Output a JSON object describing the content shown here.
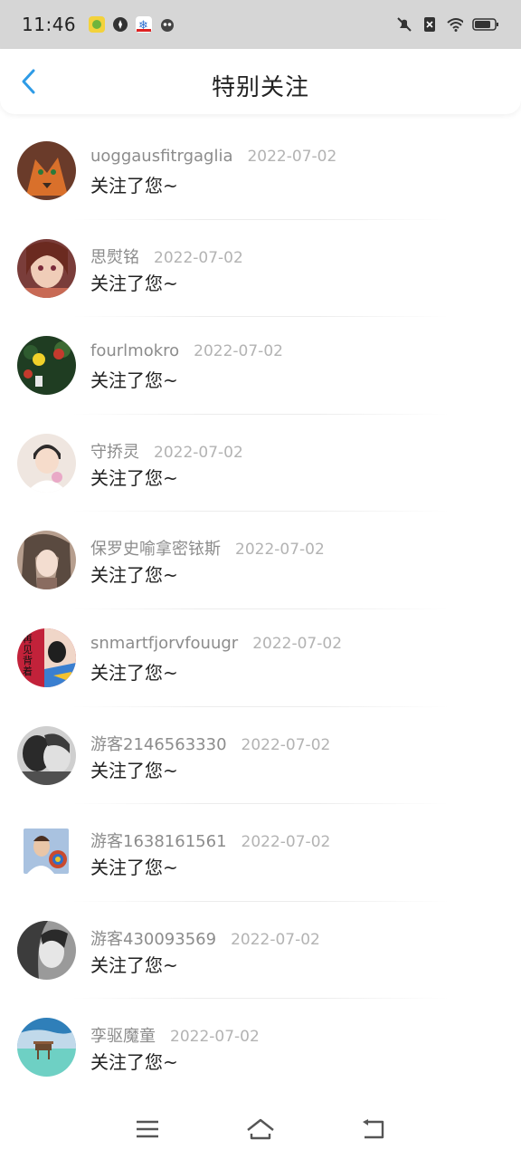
{
  "status_bar": {
    "time": "11:46",
    "apps": [
      "app-yellow-icon",
      "app-compass-icon",
      "app-snowflake-icon",
      "app-cat-icon"
    ],
    "system": [
      "mute-icon",
      "sim-icon",
      "wifi-icon",
      "battery-icon"
    ]
  },
  "header": {
    "title": "特别关注",
    "back_icon": "chevron-left-icon",
    "accent": "#2e9be6"
  },
  "items": [
    {
      "username": "uoggausfitrgaglia",
      "date": "2022-07-02",
      "message": "关注了您~",
      "avatar_colors": [
        "#d9702b",
        "#6a3b2a"
      ]
    },
    {
      "username": "思熨铭",
      "date": "2022-07-02",
      "message": "关注了您~",
      "avatar_colors": [
        "#c86a55",
        "#7a3d3a"
      ]
    },
    {
      "username": "fourlmokro",
      "date": "2022-07-02",
      "message": "关注了您~",
      "avatar_colors": [
        "#2e5b2f",
        "#c43a2d"
      ]
    },
    {
      "username": "守挢灵",
      "date": "2022-07-02",
      "message": "关注了您~",
      "avatar_colors": [
        "#efe6e0",
        "#2d2b2b"
      ]
    },
    {
      "username": "保罗史喻拿密铱斯",
      "date": "2022-07-02",
      "message": "关注了您~",
      "avatar_colors": [
        "#b69e8e",
        "#5a4a40"
      ]
    },
    {
      "username": "snmartfjorvfouugr",
      "date": "2022-07-02",
      "message": "关注了您~",
      "avatar_colors": [
        "#c2223a",
        "#f0d6c8"
      ],
      "avatar_text": "再见背着"
    },
    {
      "username": "游客2146563330",
      "date": "2022-07-02",
      "message": "关注了您~",
      "avatar_colors": [
        "#505050",
        "#cfcfcf"
      ]
    },
    {
      "username": "游客1638161561",
      "date": "2022-07-02",
      "message": "关注了您~",
      "avatar_colors": [
        "#a9c2e0",
        "#c94a2e"
      ]
    },
    {
      "username": "游客430093569",
      "date": "2022-07-02",
      "message": "关注了您~",
      "avatar_colors": [
        "#3c3c3c",
        "#9a9a9a"
      ]
    },
    {
      "username": "孪驱魔童",
      "date": "2022-07-02",
      "message": "关注了您~",
      "avatar_colors": [
        "#2f7fb9",
        "#6ed0c4"
      ]
    }
  ],
  "nav_bar": {
    "menu_icon": "menu-icon",
    "home_icon": "home-icon",
    "back_icon": "back-icon"
  }
}
